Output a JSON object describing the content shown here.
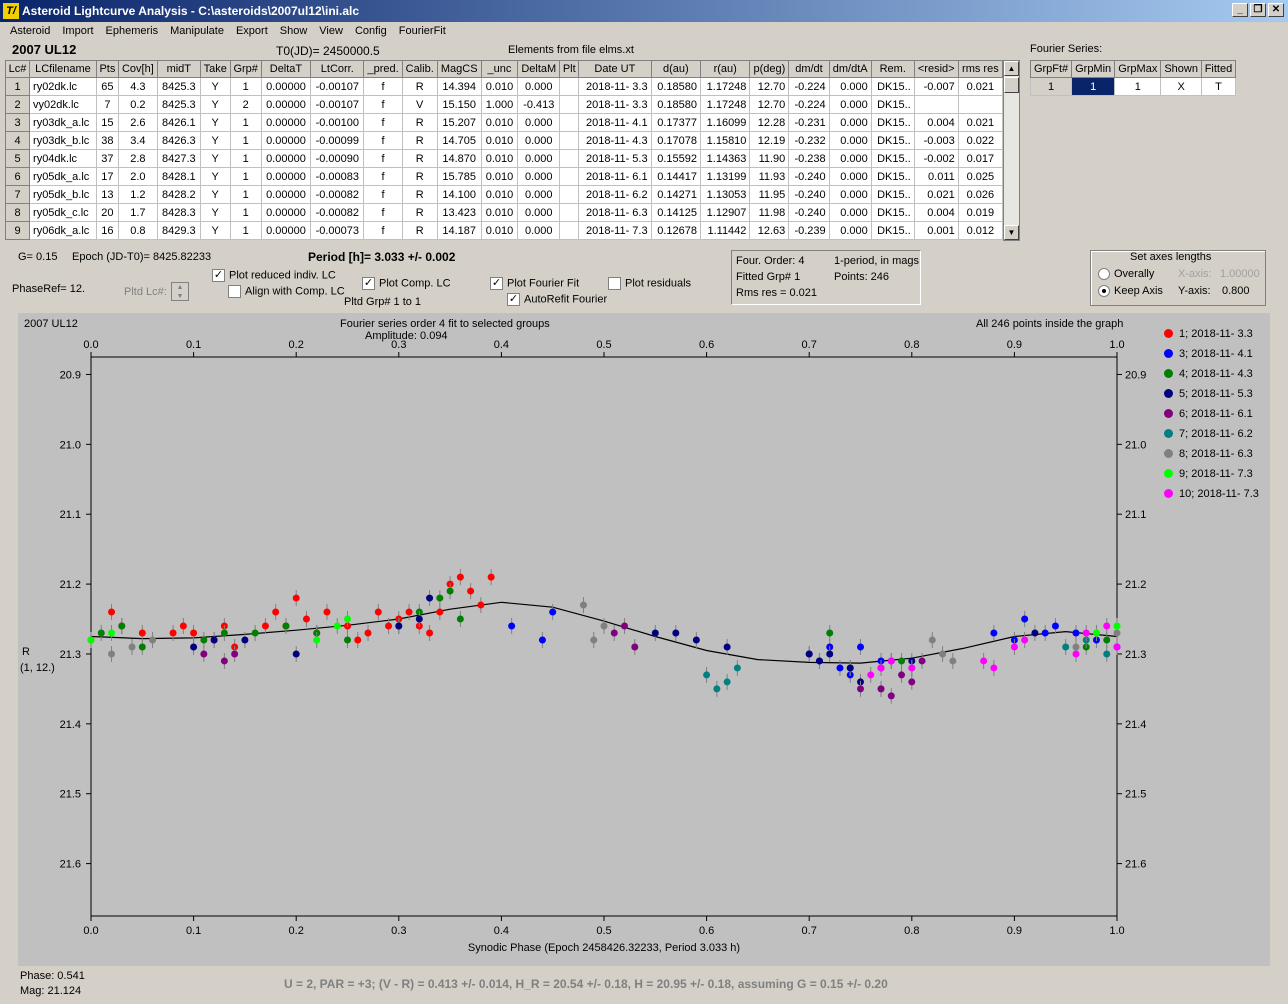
{
  "window": {
    "title": "Asteroid Lightcurve Analysis - C:\\asteroids\\2007ul12\\ini.alc",
    "icon_text": "T/"
  },
  "menu": [
    "Asteroid",
    "Import",
    "Ephemeris",
    "Manipulate",
    "Export",
    "Show",
    "View",
    "Config",
    "FourierFit"
  ],
  "header": {
    "object": "2007 UL12",
    "t0": "T0(JD)= 2450000.5",
    "elements": "Elements from file elms.xt"
  },
  "lc_table": {
    "columns": [
      "Lc#",
      "LCfilename",
      "Pts",
      "Cov[h]",
      "midT",
      "Take",
      "Grp#",
      "DeltaT",
      "LtCorr.",
      "_pred.",
      "Calib.",
      "MagCS",
      "_unc",
      "DeltaM",
      "Plt",
      "Date UT",
      "d(au)",
      "r(au)",
      "p(deg)",
      "dm/dt",
      "dm/dtA",
      "Rem.",
      "<resid>",
      "rms res"
    ],
    "rows": [
      [
        "1",
        "ry02dk.lc",
        "65",
        "4.3",
        "8425.3",
        "Y",
        "1",
        "0.00000",
        "-0.00107",
        "f",
        "R",
        "14.394",
        "0.010",
        "0.000",
        "",
        "2018-11- 3.3",
        "0.18580",
        "1.17248",
        "12.70",
        "-0.224",
        "0.000",
        "DK15..",
        "-0.007",
        "0.021"
      ],
      [
        "2",
        "vy02dk.lc",
        "7",
        "0.2",
        "8425.3",
        "Y",
        "2",
        "0.00000",
        "-0.00107",
        "f",
        "V",
        "15.150",
        "1.000",
        "-0.413",
        "",
        "2018-11- 3.3",
        "0.18580",
        "1.17248",
        "12.70",
        "-0.224",
        "0.000",
        "DK15..",
        "",
        ""
      ],
      [
        "3",
        "ry03dk_a.lc",
        "15",
        "2.6",
        "8426.1",
        "Y",
        "1",
        "0.00000",
        "-0.00100",
        "f",
        "R",
        "15.207",
        "0.010",
        "0.000",
        "",
        "2018-11- 4.1",
        "0.17377",
        "1.16099",
        "12.28",
        "-0.231",
        "0.000",
        "DK15..",
        "0.004",
        "0.021"
      ],
      [
        "4",
        "ry03dk_b.lc",
        "38",
        "3.4",
        "8426.3",
        "Y",
        "1",
        "0.00000",
        "-0.00099",
        "f",
        "R",
        "14.705",
        "0.010",
        "0.000",
        "",
        "2018-11- 4.3",
        "0.17078",
        "1.15810",
        "12.19",
        "-0.232",
        "0.000",
        "DK15..",
        "-0.003",
        "0.022"
      ],
      [
        "5",
        "ry04dk.lc",
        "37",
        "2.8",
        "8427.3",
        "Y",
        "1",
        "0.00000",
        "-0.00090",
        "f",
        "R",
        "14.870",
        "0.010",
        "0.000",
        "",
        "2018-11- 5.3",
        "0.15592",
        "1.14363",
        "11.90",
        "-0.238",
        "0.000",
        "DK15..",
        "-0.002",
        "0.017"
      ],
      [
        "6",
        "ry05dk_a.lc",
        "17",
        "2.0",
        "8428.1",
        "Y",
        "1",
        "0.00000",
        "-0.00083",
        "f",
        "R",
        "15.785",
        "0.010",
        "0.000",
        "",
        "2018-11- 6.1",
        "0.14417",
        "1.13199",
        "11.93",
        "-0.240",
        "0.000",
        "DK15..",
        "0.011",
        "0.025"
      ],
      [
        "7",
        "ry05dk_b.lc",
        "13",
        "1.2",
        "8428.2",
        "Y",
        "1",
        "0.00000",
        "-0.00082",
        "f",
        "R",
        "14.100",
        "0.010",
        "0.000",
        "",
        "2018-11- 6.2",
        "0.14271",
        "1.13053",
        "11.95",
        "-0.240",
        "0.000",
        "DK15..",
        "0.021",
        "0.026"
      ],
      [
        "8",
        "ry05dk_c.lc",
        "20",
        "1.7",
        "8428.3",
        "Y",
        "1",
        "0.00000",
        "-0.00082",
        "f",
        "R",
        "13.423",
        "0.010",
        "0.000",
        "",
        "2018-11- 6.3",
        "0.14125",
        "1.12907",
        "11.98",
        "-0.240",
        "0.000",
        "DK15..",
        "0.004",
        "0.019"
      ],
      [
        "9",
        "ry06dk_a.lc",
        "16",
        "0.8",
        "8429.3",
        "Y",
        "1",
        "0.00000",
        "-0.00073",
        "f",
        "R",
        "14.187",
        "0.010",
        "0.000",
        "",
        "2018-11- 7.3",
        "0.12678",
        "1.11442",
        "12.63",
        "-0.239",
        "0.000",
        "DK15..",
        "0.001",
        "0.012"
      ]
    ]
  },
  "fourier_series": {
    "title": "Fourier Series:",
    "columns": [
      "GrpFt#",
      "GrpMin",
      "GrpMax",
      "Shown",
      "Fitted"
    ],
    "row": [
      "1",
      "1",
      "1",
      "X",
      "T"
    ]
  },
  "controls": {
    "g_value": "G= 0.15",
    "epoch": "Epoch (JD-T0)= 8425.82233",
    "period": "Period [h]= 3.033 +/- 0.002",
    "phaseref": "PhaseRef= 12.",
    "pltd_lc": "Pltd Lc#:",
    "plot_reduced": "Plot reduced indiv. LC",
    "align_comp": "Align with Comp. LC",
    "plot_comp": "Plot Comp. LC",
    "pltd_grp": "Pltd Grp#  1   to   1",
    "plot_fourier": "Plot Fourier Fit",
    "autorefit": "AutoRefit Fourier",
    "plot_residuals": "Plot residuals"
  },
  "fit_info": {
    "four_order": "Four. Order:  4",
    "period_note": "1-period, in mags",
    "fitted_grp": "Fitted Grp# 1",
    "points": "Points: 246",
    "rms": "Rms res     = 0.021"
  },
  "axes_box": {
    "title": "Set axes lengths",
    "overally": "Overally",
    "keep_axis": "Keep Axis",
    "x_label": "X-axis:",
    "x_value": "1.00000",
    "y_label": "Y-axis:",
    "y_value": "0.800"
  },
  "plot_header": {
    "object": "2007 UL12",
    "caption1": "Fourier series order 4 fit to selected groups",
    "caption2": "Amplitude: 0.094",
    "inside": "All 246 points inside the graph",
    "ylabel1": "R",
    "ylabel2": "(1, 12.)"
  },
  "status": {
    "phase": "Phase:  0.541",
    "mag": "Mag:   21.124",
    "summary": "U = 2, PAR = +3; (V - R) = 0.413 +/- 0.014, H_R = 20.54 +/- 0.18, H = 20.95 +/- 0.18, assuming G = 0.15 +/- 0.20"
  },
  "chart_data": {
    "type": "scatter",
    "xlabel": "Synodic Phase (Epoch 2458426.32233, Period 3.033 h)",
    "ylabel": "R",
    "xlim": [
      0.0,
      1.0
    ],
    "ylim": [
      21.675,
      20.875
    ],
    "y_inverted": true,
    "xticks": [
      0.0,
      0.1,
      0.2,
      0.3,
      0.4,
      0.5,
      0.6,
      0.7,
      0.8,
      0.9,
      1.0
    ],
    "xtick_labels": [
      "0.0",
      "0.1",
      "0.2",
      "0.3",
      "0.4",
      "0.5",
      "0.6",
      "0.7",
      "0.8",
      "0.9",
      "1.0"
    ],
    "yticks": [
      20.9,
      21.0,
      21.1,
      21.2,
      21.3,
      21.4,
      21.5,
      21.6
    ],
    "ytick_labels": [
      "20.9",
      "21.0",
      "21.1",
      "21.2",
      "21.3",
      "21.4",
      "21.5",
      "21.6"
    ],
    "fourier_curve": {
      "x": [
        0.0,
        0.05,
        0.1,
        0.15,
        0.2,
        0.25,
        0.3,
        0.35,
        0.4,
        0.45,
        0.5,
        0.55,
        0.6,
        0.65,
        0.7,
        0.75,
        0.8,
        0.85,
        0.9,
        0.95,
        1.0
      ],
      "y": [
        21.275,
        21.278,
        21.277,
        21.272,
        21.266,
        21.259,
        21.25,
        21.236,
        21.226,
        21.233,
        21.253,
        21.275,
        21.295,
        21.308,
        21.312,
        21.313,
        21.306,
        21.292,
        21.275,
        21.268,
        21.275
      ]
    },
    "series": [
      {
        "name": "1; 2018-11- 3.3",
        "color": "#ff0000",
        "x": [
          0.0,
          0.02,
          0.03,
          0.05,
          0.08,
          0.09,
          0.1,
          0.12,
          0.13,
          0.14,
          0.17,
          0.18,
          0.19,
          0.2,
          0.21,
          0.22,
          0.23,
          0.25,
          0.26,
          0.27,
          0.28,
          0.29,
          0.3,
          0.31,
          0.32,
          0.33,
          0.34,
          0.35,
          0.36,
          0.37,
          0.38,
          0.39
        ],
        "y": [
          21.28,
          21.24,
          21.26,
          21.27,
          21.27,
          21.26,
          21.27,
          21.28,
          21.26,
          21.29,
          21.26,
          21.24,
          21.26,
          21.22,
          21.25,
          21.27,
          21.24,
          21.26,
          21.28,
          21.27,
          21.24,
          21.26,
          21.25,
          21.24,
          21.26,
          21.27,
          21.24,
          21.2,
          21.19,
          21.21,
          21.23,
          21.19
        ]
      },
      {
        "name": "3; 2018-11- 4.1",
        "color": "#0000ff",
        "x": [
          0.41,
          0.44,
          0.45,
          0.7,
          0.71,
          0.72,
          0.73,
          0.74,
          0.75,
          0.77,
          0.88,
          0.9,
          0.91,
          0.93,
          0.94,
          0.96,
          0.98,
          1.0
        ],
        "y": [
          21.26,
          21.28,
          21.24,
          21.3,
          21.31,
          21.29,
          21.32,
          21.33,
          21.29,
          21.31,
          21.27,
          21.28,
          21.25,
          21.27,
          21.26,
          21.27,
          21.28,
          21.29
        ]
      },
      {
        "name": "4; 2018-11- 4.3",
        "color": "#008000",
        "x": [
          0.01,
          0.03,
          0.05,
          0.11,
          0.13,
          0.16,
          0.19,
          0.22,
          0.25,
          0.3,
          0.32,
          0.34,
          0.35,
          0.36,
          0.72,
          0.74,
          0.77,
          0.79,
          0.97,
          0.99
        ],
        "y": [
          21.27,
          21.26,
          21.29,
          21.28,
          21.27,
          21.27,
          21.26,
          21.27,
          21.28,
          21.26,
          21.24,
          21.22,
          21.21,
          21.25,
          21.27,
          21.32,
          21.35,
          21.31,
          21.29,
          21.28
        ]
      },
      {
        "name": "5; 2018-11- 5.3",
        "color": "#000080",
        "x": [
          0.1,
          0.12,
          0.15,
          0.2,
          0.3,
          0.32,
          0.33,
          0.55,
          0.57,
          0.59,
          0.62,
          0.7,
          0.71,
          0.72,
          0.74,
          0.75,
          0.77,
          0.78,
          0.8,
          0.92
        ],
        "y": [
          21.29,
          21.28,
          21.28,
          21.3,
          21.26,
          21.25,
          21.22,
          21.27,
          21.27,
          21.28,
          21.29,
          21.3,
          21.31,
          21.3,
          21.32,
          21.34,
          21.32,
          21.31,
          21.31,
          21.27
        ]
      },
      {
        "name": "6; 2018-11- 6.1",
        "color": "#800080",
        "x": [
          0.11,
          0.13,
          0.14,
          0.51,
          0.52,
          0.53,
          0.75,
          0.77,
          0.78,
          0.79,
          0.8,
          0.81
        ],
        "y": [
          21.3,
          21.31,
          21.3,
          21.27,
          21.26,
          21.29,
          21.35,
          21.35,
          21.36,
          21.33,
          21.34,
          21.31
        ]
      },
      {
        "name": "7; 2018-11- 6.2",
        "color": "#008080",
        "x": [
          0.6,
          0.61,
          0.62,
          0.63,
          0.95,
          0.97,
          0.99
        ],
        "y": [
          21.33,
          21.35,
          21.34,
          21.32,
          21.29,
          21.28,
          21.3
        ]
      },
      {
        "name": "8; 2018-11- 6.3",
        "color": "#808080",
        "x": [
          0.02,
          0.04,
          0.06,
          0.48,
          0.49,
          0.5,
          0.8,
          0.82,
          0.83,
          0.84,
          0.96,
          1.0
        ],
        "y": [
          21.3,
          21.29,
          21.28,
          21.23,
          21.28,
          21.26,
          21.32,
          21.28,
          21.3,
          21.31,
          21.29,
          21.27
        ]
      },
      {
        "name": "9; 2018-11- 7.3",
        "color": "#00ff00",
        "x": [
          0.0,
          0.02,
          0.22,
          0.24,
          0.25,
          0.98,
          1.0
        ],
        "y": [
          21.28,
          21.27,
          21.28,
          21.26,
          21.25,
          21.27,
          21.26
        ]
      },
      {
        "name": "10; 2018-11- 7.3",
        "color": "#ff00ff",
        "x": [
          0.76,
          0.77,
          0.78,
          0.8,
          0.87,
          0.88,
          0.9,
          0.91,
          0.96,
          0.97,
          0.99,
          1.0
        ],
        "y": [
          21.33,
          21.32,
          21.31,
          21.32,
          21.31,
          21.32,
          21.29,
          21.28,
          21.3,
          21.27,
          21.26,
          21.29
        ]
      }
    ]
  }
}
